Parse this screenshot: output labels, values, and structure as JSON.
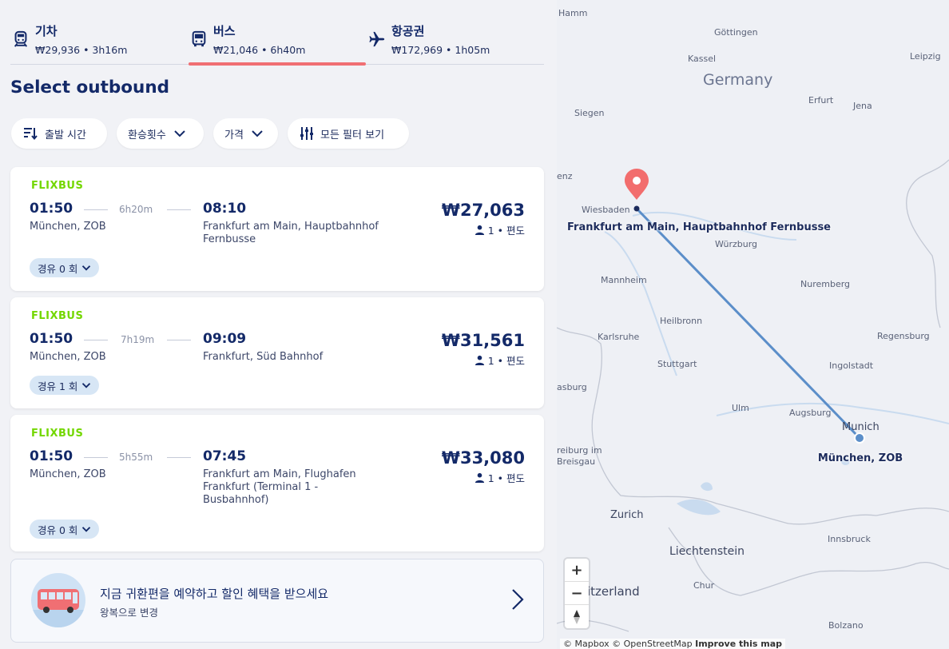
{
  "tabs": [
    {
      "name": "기차",
      "sub": "₩29,936 • 3h16m",
      "icon": "train-icon",
      "active": false
    },
    {
      "name": "버스",
      "sub": "₩21,046 • 6h40m",
      "icon": "bus-icon",
      "active": true
    },
    {
      "name": "항공권",
      "sub": "₩172,969 • 1h05m",
      "icon": "plane-icon",
      "active": false
    }
  ],
  "heading": "Select outbound",
  "filters": {
    "departure_time": "출발 시간",
    "transfers": "환승횟수",
    "price": "가격",
    "all_filters": "모든 필터 보기"
  },
  "results": [
    {
      "brand": "FLIXBUS",
      "dep_time": "01:50",
      "dep_stop": "München, ZOB",
      "duration": "6h20m",
      "arr_time": "08:10",
      "arr_stop": "Frankfurt am Main, Hauptbahnhof Fernbusse",
      "price": "₩27,063",
      "pax": "1 • 편도",
      "stops": "경유 0 회"
    },
    {
      "brand": "FLIXBUS",
      "dep_time": "01:50",
      "dep_stop": "München, ZOB",
      "duration": "7h19m",
      "arr_time": "09:09",
      "arr_stop": "Frankfurt, Süd Bahnhof",
      "price": "₩31,561",
      "pax": "1 • 편도",
      "stops": "경유 1 회"
    },
    {
      "brand": "FLIXBUS",
      "dep_time": "01:50",
      "dep_stop": "München, ZOB",
      "duration": "5h55m",
      "arr_time": "07:45",
      "arr_stop": "Frankfurt am Main, Flughafen Frankfurt (Terminal 1 - Busbahnhof)",
      "price": "₩33,080",
      "pax": "1 • 편도",
      "stops": "경유 0 회"
    }
  ],
  "promo": {
    "title": "지금 귀환편을 예약하고 할인 혜택을 받으세요",
    "subtitle": "왕복으로 변경"
  },
  "map": {
    "country": "Germany",
    "cities": [
      "Hamm",
      "Göttingen",
      "Kassel",
      "Leipzig",
      "Erfurt",
      "Jena",
      "Siegen",
      "enz",
      "Wiesbaden",
      "Würzburg",
      "Mannheim",
      "Nuremberg",
      "Heilbronn",
      "Karlsruhe",
      "Regensburg",
      "Stuttgart",
      "Ingolstadt",
      "asburg",
      "Ulm",
      "Augsburg",
      "reiburg im Breisgau",
      "Innsbruck",
      "Chur",
      "Bolzano"
    ],
    "big_cities": {
      "munich": "Munich",
      "zurich": "Zurich"
    },
    "regions": {
      "liechtenstein": "Liechtenstein",
      "switzerland": "itzerland"
    },
    "origin_label": "München, ZOB",
    "destination_label": "Frankfurt am Main, Hauptbahnhof Fernbusse",
    "zoom_in": "+",
    "zoom_out": "−",
    "attribution_1": "© Mapbox",
    "attribution_2": "© OpenStreetMap",
    "attribution_3": "Improve this map"
  },
  "colors": {
    "brand_green": "#73d700",
    "active_tab_underline": "#f06f73",
    "navy_text": "#132968",
    "route_line": "#5b8ec9",
    "destination_pin": "#f26d6d"
  }
}
